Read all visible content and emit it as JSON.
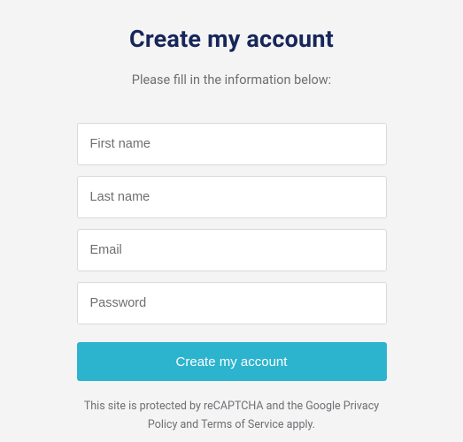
{
  "title": "Create my account",
  "subtitle": "Please fill in the information below:",
  "fields": {
    "first_name_placeholder": "First name",
    "last_name_placeholder": "Last name",
    "email_placeholder": "Email",
    "password_placeholder": "Password"
  },
  "submit_label": "Create my account",
  "disclaimer": "This site is protected by reCAPTCHA and the Google Privacy Policy and Terms of Service apply."
}
